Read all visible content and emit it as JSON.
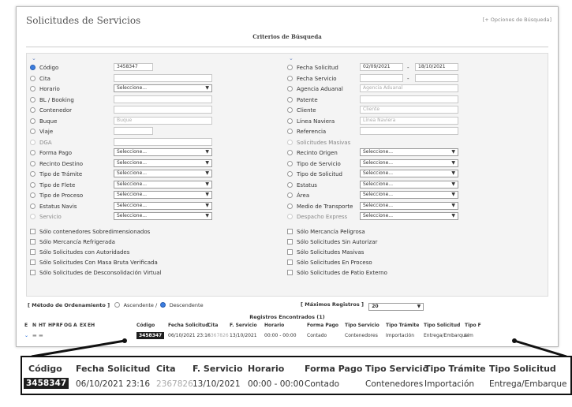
{
  "header": {
    "title": "Solicitudes de Servicios",
    "advanced_link": "[+ Opciones de Búsqueda]"
  },
  "criteria_title": "Criterios de Búsqueda",
  "left_fields": [
    {
      "label": "Código",
      "kind": "input",
      "value": "3458347",
      "selected": true
    },
    {
      "label": "Cita",
      "kind": "input",
      "value": ""
    },
    {
      "label": "Horario",
      "kind": "select",
      "value": "Seleccione..."
    },
    {
      "label": "BL / Booking",
      "kind": "input",
      "value": ""
    },
    {
      "label": "Contenedor",
      "kind": "input",
      "value": ""
    },
    {
      "label": "Buque",
      "kind": "input",
      "value": "Buque",
      "placeholder": true
    },
    {
      "label": "Viaje",
      "kind": "input",
      "value": ""
    },
    {
      "label": "DGA",
      "kind": "input",
      "value": "",
      "disabled": true
    },
    {
      "label": "Forma Pago",
      "kind": "select",
      "value": "Seleccione..."
    },
    {
      "label": "Recinto Destino",
      "kind": "select",
      "value": "Seleccione..."
    },
    {
      "label": "Tipo de Trámite",
      "kind": "select",
      "value": "Seleccione..."
    },
    {
      "label": "Tipo de Flete",
      "kind": "select",
      "value": "Seleccione..."
    },
    {
      "label": "Tipo de Proceso",
      "kind": "select",
      "value": "Seleccione..."
    },
    {
      "label": "Estatus Navis",
      "kind": "select",
      "value": "Seleccione..."
    },
    {
      "label": "Servicio",
      "kind": "select",
      "value": "Seleccione...",
      "disabled": true
    }
  ],
  "right_fields": [
    {
      "label": "Fecha Solicitud",
      "kind": "range",
      "value": "02/09/2021",
      "value2": "18/10/2021"
    },
    {
      "label": "Fecha Servicio",
      "kind": "range",
      "value": "",
      "value2": ""
    },
    {
      "label": "Agencia Aduanal",
      "kind": "input",
      "value": "Agencia Aduanal",
      "placeholder": true
    },
    {
      "label": "Patente",
      "kind": "input",
      "value": ""
    },
    {
      "label": "Cliente",
      "kind": "input",
      "value": "Cliente",
      "placeholder": true
    },
    {
      "label": "Línea Naviera",
      "kind": "input",
      "value": "Línea Naviera",
      "placeholder": true
    },
    {
      "label": "Referencia",
      "kind": "input",
      "value": ""
    },
    {
      "label": "Solicitudes Masivas",
      "kind": "none",
      "value": "",
      "disabled": true
    },
    {
      "label": "Recinto Origen",
      "kind": "select",
      "value": "Seleccione..."
    },
    {
      "label": "Tipo de Servicio",
      "kind": "select",
      "value": "Seleccione..."
    },
    {
      "label": "Tipo de Solicitud",
      "kind": "select",
      "value": "Seleccione..."
    },
    {
      "label": "Estatus",
      "kind": "select",
      "value": "Seleccione..."
    },
    {
      "label": "Área",
      "kind": "select",
      "value": "Seleccione..."
    },
    {
      "label": "Medio de Transporte",
      "kind": "select",
      "value": "Seleccione..."
    },
    {
      "label": "Despacho Express",
      "kind": "select",
      "value": "Seleccione...",
      "disabled": true
    }
  ],
  "left_checks": [
    "Sólo contenedores Sobredimensionados",
    "Sólo Mercancía Refrigerada",
    "Sólo Solicitudes con Autoridades",
    "Sólo Solicitudes Con Masa Bruta Verificada",
    "Sólo Solicitudes de Desconsolidación Virtual"
  ],
  "right_checks": [
    "Sólo Mercancía Peligrosa",
    "Sólo Solicitudes Sin Autorizar",
    "Sólo Solicitudes Masivas",
    "Sólo Solicitudes En Proceso",
    "Sólo Solicitudes de Patio Externo"
  ],
  "ordering": {
    "label": "[ Método de Ordenamiento ]",
    "asc": "Ascendente /",
    "desc": "Descendente"
  },
  "max_records": {
    "label": "[ Máximos Registros ]",
    "value": "20"
  },
  "results_title": "Registros Encontrados (1)",
  "table": {
    "flags": [
      "E",
      "N",
      "HT",
      "HP",
      "RF",
      "OG",
      "A",
      "EX",
      "EH"
    ],
    "headers": [
      "Código",
      "Fecha Solicitud",
      "Cita",
      "F. Servicio",
      "Horario",
      "Forma Pago",
      "Tipo Servicio",
      "Tipo Trámite",
      "Tipo Solicitud",
      "Tipo F"
    ],
    "row": [
      "3458347",
      "06/10/2021 23:16",
      "2367826",
      "13/10/2021",
      "00:00 - 00:00",
      "Contado",
      "Contenedores",
      "Importación",
      "Entrega/Embarque",
      "Lim"
    ]
  },
  "zoom": {
    "headers": [
      "Código",
      "Fecha Solicitud",
      "Cita",
      "F. Servicio",
      "Horario",
      "Forma Pago",
      "Tipo Servicio",
      "Tipo Trámite",
      "Tipo Solicitud"
    ],
    "row": [
      "3458347",
      "06/10/2021 23:16",
      "2367826",
      "13/10/2021",
      "00:00 - 00:00",
      "Contado",
      "Contenedores",
      "Importación",
      "Entrega/Embarque"
    ]
  },
  "colors": {
    "accent": "#3b7de0",
    "highlight": "#1f1f1f"
  }
}
